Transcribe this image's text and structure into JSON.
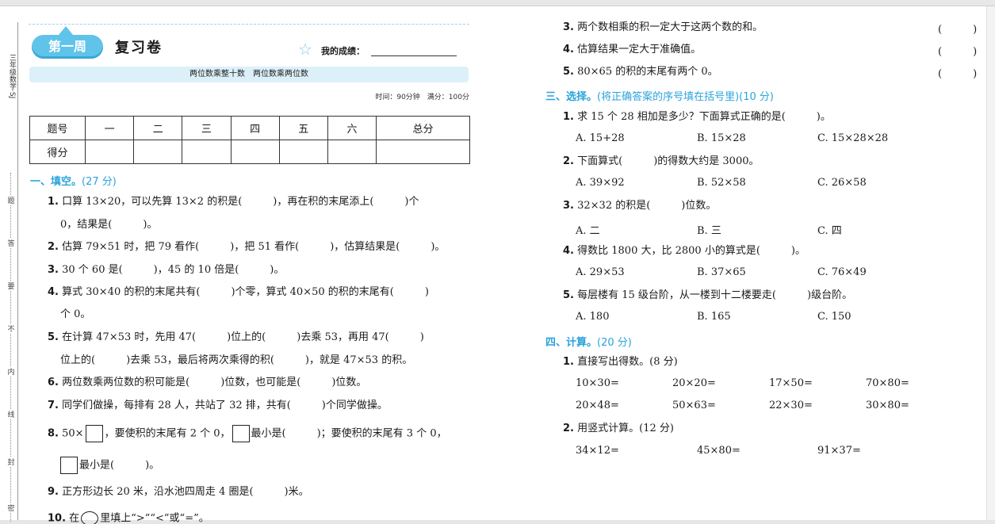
{
  "margin": {
    "title": "三年级数学·SJ",
    "chars": [
      "题",
      "答",
      "要",
      "不",
      "内",
      "线",
      "封",
      "密"
    ]
  },
  "header": {
    "week_badge": "第一周",
    "title": "复习卷",
    "score_label": "我的成绩：",
    "subtitle": "两位数乘整十数　两位数乘两位数",
    "time_info": "时间：90分钟　满分：100分"
  },
  "score_table": {
    "row1": [
      "题号",
      "一",
      "二",
      "三",
      "四",
      "五",
      "六",
      "总分"
    ],
    "row2_label": "得分"
  },
  "section1": {
    "heading": "一、填空。",
    "points": "(27 分)",
    "q1_num": "1.",
    "q1_text": "口算 13×20，可以先算 13×2 的积是(　　　)，再在积的末尾添上(　　　)个",
    "q1_cont": "0，结果是(　　　)。",
    "q2_num": "2.",
    "q2_text": "估算 79×51 时，把 79 看作(　　　)，把 51 看作(　　　)，估算结果是(　　　)。",
    "q3_num": "3.",
    "q3_text": "30 个 60 是(　　　)，45 的 10 倍是(　　　)。",
    "q4_num": "4.",
    "q4_text": "算式 30×40 的积的末尾共有(　　　)个零，算式 40×50 的积的末尾有(　　　)",
    "q4_cont": "个 0。",
    "q5_num": "5.",
    "q5_text": "在计算 47×53 时，先用 47(　　　)位上的(　　　)去乘 53，再用 47(　　　)",
    "q5_cont": "位上的(　　　)去乘 53，最后将两次乘得的积(　　　)，就是 47×53 的积。",
    "q6_num": "6.",
    "q6_text": "两位数乘两位数的积可能是(　　　)位数，也可能是(　　　)位数。",
    "q7_num": "7.",
    "q7_text": "同学们做操，每排有 28 人，共站了 32 排，共有(　　　)个同学做操。",
    "q8_num": "8.",
    "q8_a": "50×",
    "q8_b": "，要使积的末尾有 2 个 0，",
    "q8_c": "最小是(　　　)；要使积的末尾有 3 个 0，",
    "q8_d": "最小是(　　　)。",
    "q9_num": "9.",
    "q9_text": "正方形边长 20 米，沿水池四周走 4 圈是(　　　)米。",
    "q10_num": "10.",
    "q10_a": "在",
    "q10_b": "里填上“>”“<”或“=”。"
  },
  "section2_cont": {
    "q3_num": "3.",
    "q3_text": "两个数相乘的积一定大于这两个数的和。",
    "q4_num": "4.",
    "q4_text": "估算结果一定大于准确值。",
    "q5_num": "5.",
    "q5_text": "80×65 的积的末尾有两个 0。",
    "paren": "(　　　)"
  },
  "section3": {
    "heading": "三、选择。",
    "points": "(将正确答案的序号填在括号里)(10 分)",
    "q1_num": "1.",
    "q1_text": "求 15 个 28 相加是多少？下面算式正确的是(　　　)。",
    "q1_opts": [
      "A. 15+28",
      "B. 15×28",
      "C. 15×28×28"
    ],
    "q2_num": "2.",
    "q2_text": "下面算式(　　　)的得数大约是 3000。",
    "q2_opts": [
      "A. 39×92",
      "B. 52×58",
      "C. 26×58"
    ],
    "q3_num": "3.",
    "q3_text": "32×32 的积是(　　　)位数。",
    "q3_opts": [
      "A. 二",
      "B. 三",
      "C. 四"
    ],
    "q4_num": "4.",
    "q4_text": "得数比 1800 大，比 2800 小的算式是(　　　)。",
    "q4_opts": [
      "A. 29×53",
      "B. 37×65",
      "C. 76×49"
    ],
    "q5_num": "5.",
    "q5_text": "每层楼有 15 级台阶，从一楼到十二楼要走(　　　)级台阶。",
    "q5_opts": [
      "A. 180",
      "B. 165",
      "C. 150"
    ]
  },
  "section4": {
    "heading": "四、计算。",
    "points": "(20 分)",
    "p1_num": "1.",
    "p1_text": "直接写出得数。(8 分)",
    "row1": [
      "10×30=",
      "20×20=",
      "17×50=",
      "70×80="
    ],
    "row2": [
      "20×48=",
      "50×63=",
      "22×30=",
      "30×80="
    ],
    "p2_num": "2.",
    "p2_text": "用竖式计算。(12 分)",
    "row3": [
      "34×12=",
      "45×80=",
      "91×37="
    ]
  }
}
